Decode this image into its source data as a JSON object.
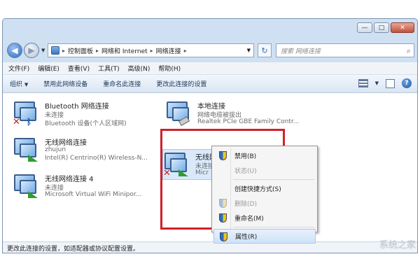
{
  "window": {
    "buttons": {
      "minimize": "—",
      "maximize": "□",
      "close": "✕"
    }
  },
  "address": {
    "crumbs": [
      "控制面板",
      "网络和 Internet",
      "网络连接"
    ],
    "separator": "▸",
    "search_placeholder": "搜索 网络连接"
  },
  "menu": [
    "文件(F)",
    "编辑(E)",
    "查看(V)",
    "工具(T)",
    "高级(N)",
    "帮助(H)"
  ],
  "toolbar": {
    "organize": "组织",
    "disable": "禁用此网络设备",
    "rename": "重命名此连接",
    "change": "更改此连接的设置"
  },
  "connections": [
    {
      "name": "Bluetooth 网络连接",
      "status": "未连接",
      "device": "Bluetooth 设备(个人区域网)",
      "type": "bluetooth",
      "disconnected": true
    },
    {
      "name": "本地连接",
      "status": "网络电缆被拔出",
      "device": "Realtek PCIe GBE Family Contr...",
      "type": "wired",
      "disconnected": true
    },
    {
      "name": "无线网络连接",
      "status": "zhujun",
      "device": "Intel(R) Centrino(R) Wireless-N...",
      "type": "wireless",
      "disconnected": false
    },
    {
      "name": "无线网络连接 2",
      "status": "未连接",
      "device": "Micr",
      "type": "wireless",
      "disconnected": true
    },
    {
      "name": "无线网络连接 4",
      "status": "未连接",
      "device": "Microsoft Virtual WiFi Minipor...",
      "type": "wireless",
      "disconnected": false
    }
  ],
  "context_menu": {
    "disable": "禁用(B)",
    "status": "状态(U)",
    "create_shortcut": "创建快捷方式(S)",
    "delete": "删除(D)",
    "rename": "重命名(M)",
    "properties": "属性(R)"
  },
  "statusbar": "更改此连接的设置，如适配器或协议配置设置。",
  "watermark": "系统之家",
  "colors": {
    "highlight": "#d0202b",
    "disconnected_x": "#cc1f1f",
    "signal": "#2e9e2e"
  }
}
